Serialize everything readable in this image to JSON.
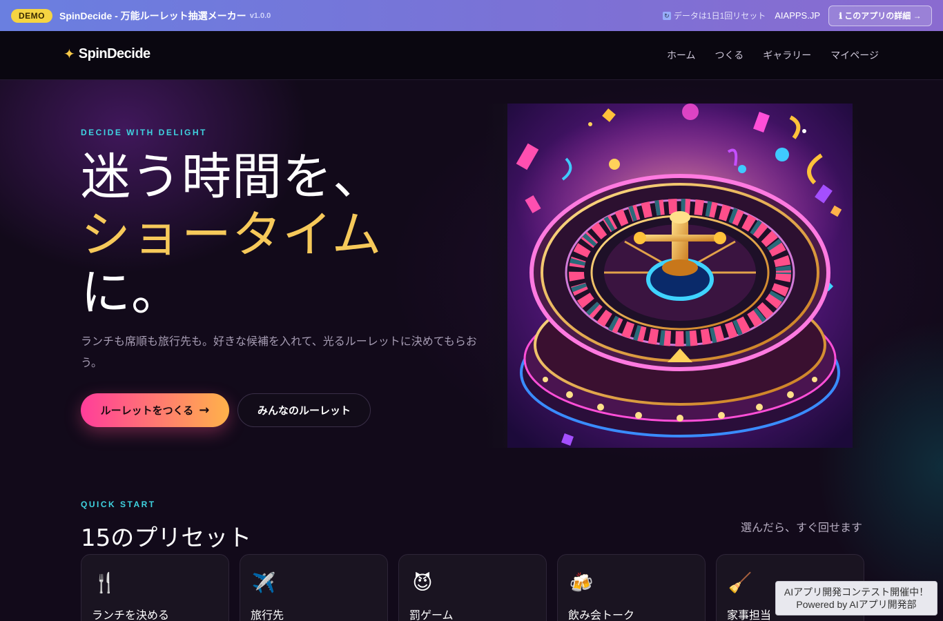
{
  "demo_bar": {
    "badge": "DEMO",
    "title": "SpinDecide - 万能ルーレット抽選メーカー",
    "version": "v1.0.0",
    "reset_notice": "データは1日1回リセット",
    "site_link": "AIAPPS.JP",
    "detail_button": "ℹ このアプリの詳細 →"
  },
  "nav": {
    "logo_star": "✦",
    "logo_text": "SpinDecide",
    "links": [
      "ホーム",
      "つくる",
      "ギャラリー",
      "マイページ"
    ]
  },
  "hero": {
    "eyebrow": "DECIDE WITH DELIGHT",
    "line1": "迷う時間を、",
    "line2": "ショータイム",
    "line3": "に。",
    "lead": "ランチも席順も旅行先も。好きな候補を入れて、光るルーレットに決めてもらおう。",
    "primary_button": "ルーレットをつくる",
    "primary_arrow": "→",
    "secondary_button": "みんなのルーレット"
  },
  "quick_start": {
    "eyebrow": "QUICK START",
    "title": "15のプリセット",
    "subtitle": "選んだら、すぐ回せます",
    "cards": [
      {
        "icon": "🍴",
        "icon_name": "fork-knife-icon",
        "label": "ランチを決める"
      },
      {
        "icon": "✈️",
        "icon_name": "airplane-icon",
        "label": "旅行先"
      },
      {
        "icon": "😈",
        "icon_name": "devil-icon",
        "label": "罰ゲーム"
      },
      {
        "icon": "🍻",
        "icon_name": "beer-mugs-icon",
        "label": "飲み会トーク"
      },
      {
        "icon": "🧹",
        "icon_name": "broom-icon",
        "label": "家事担当"
      }
    ]
  },
  "contest_badge": {
    "line1": "AIアプリ開発コンテスト開催中！",
    "line2": "Powered by AIアプリ開発部"
  },
  "colors": {
    "accent_pink": "#ff3d9a",
    "accent_orange": "#ffb24a",
    "accent_gold": "#f6c95a",
    "accent_cyan": "#3fd3e0",
    "demo_badge": "#f5d442"
  }
}
